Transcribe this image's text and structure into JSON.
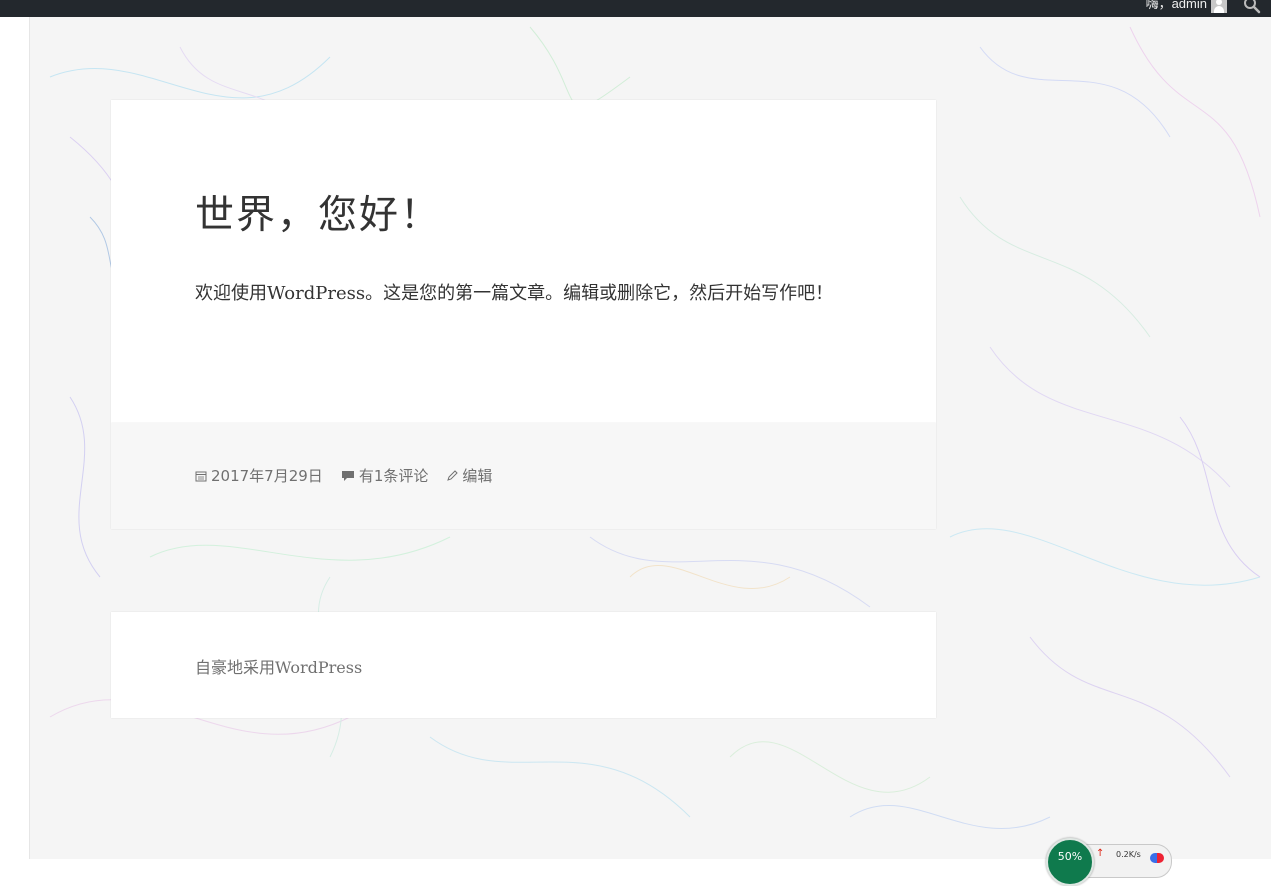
{
  "admin_bar": {
    "greeting": "嗨，admin",
    "avatar_icon": "user-avatar-icon",
    "search_icon": "search-icon"
  },
  "post": {
    "title": "世界，您好！",
    "body": "欢迎使用WordPress。这是您的第一篇文章。编辑或删除它，然后开始写作吧！",
    "meta": {
      "date": "2017年7月29日",
      "date_icon": "calendar-icon",
      "comments": "有1条评论",
      "comments_icon": "comment-icon",
      "edit": "编辑",
      "edit_icon": "pencil-icon"
    }
  },
  "site_footer": {
    "powered_by": "自豪地采用WordPress"
  },
  "network_monitor": {
    "percent": "50%",
    "speed": "0.2K/s"
  },
  "colors": {
    "admin_bar": "#23282d",
    "background": "#f5f5f5",
    "card": "#ffffff",
    "meta_text": "#707070",
    "monitor_green": "#0f7a4d"
  }
}
